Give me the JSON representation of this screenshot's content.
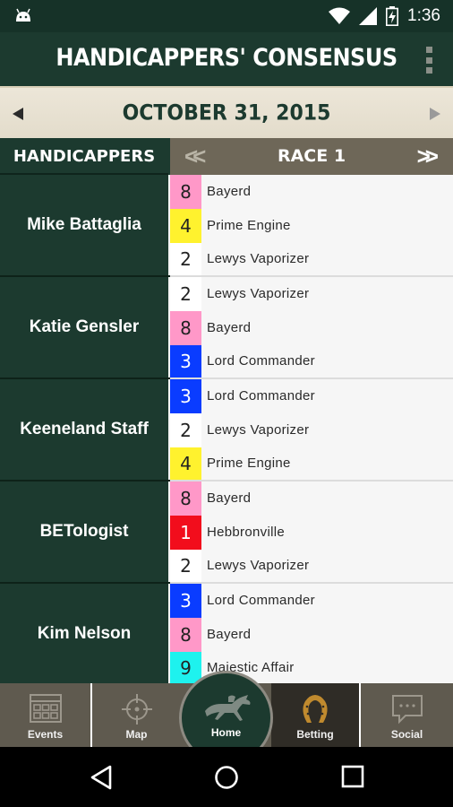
{
  "status_bar": {
    "time": "1:36"
  },
  "app_bar": {
    "title": "HANDICAPPERS' CONSENSUS"
  },
  "date_bar": {
    "date": "OCTOBER 31, 2015"
  },
  "table_header": {
    "handicappers_label": "HANDICAPPERS",
    "race_label": "RACE 1",
    "prev_symbol": "<<",
    "next_symbol": ">>"
  },
  "handicappers": [
    {
      "name": "Mike Battaglia",
      "picks": [
        {
          "number": "8",
          "horse": "Bayerd",
          "bg": "#ff98c8",
          "fg": "#222222"
        },
        {
          "number": "4",
          "horse": "Prime Engine",
          "bg": "#fff22e",
          "fg": "#222222"
        },
        {
          "number": "2",
          "horse": "Lewys Vaporizer",
          "bg": "#ffffff",
          "fg": "#222222"
        }
      ]
    },
    {
      "name": "Katie Gensler",
      "picks": [
        {
          "number": "2",
          "horse": "Lewys Vaporizer",
          "bg": "#ffffff",
          "fg": "#222222"
        },
        {
          "number": "8",
          "horse": "Bayerd",
          "bg": "#ff98c8",
          "fg": "#222222"
        },
        {
          "number": "3",
          "horse": "Lord Commander",
          "bg": "#0a3cff",
          "fg": "#ffffff"
        }
      ]
    },
    {
      "name": "Keeneland Staff",
      "picks": [
        {
          "number": "3",
          "horse": "Lord Commander",
          "bg": "#0a3cff",
          "fg": "#ffffff"
        },
        {
          "number": "2",
          "horse": "Lewys Vaporizer",
          "bg": "#ffffff",
          "fg": "#222222"
        },
        {
          "number": "4",
          "horse": "Prime Engine",
          "bg": "#fff22e",
          "fg": "#222222"
        }
      ]
    },
    {
      "name": "BETologist",
      "picks": [
        {
          "number": "8",
          "horse": "Bayerd",
          "bg": "#ff98c8",
          "fg": "#222222"
        },
        {
          "number": "1",
          "horse": "Hebbronville",
          "bg": "#f20d1c",
          "fg": "#ffffff"
        },
        {
          "number": "2",
          "horse": "Lewys Vaporizer",
          "bg": "#ffffff",
          "fg": "#222222"
        }
      ]
    },
    {
      "name": "Kim Nelson",
      "picks": [
        {
          "number": "3",
          "horse": "Lord Commander",
          "bg": "#0a3cff",
          "fg": "#ffffff"
        },
        {
          "number": "8",
          "horse": "Bayerd",
          "bg": "#ff98c8",
          "fg": "#222222"
        },
        {
          "number": "9",
          "horse": "Majestic Affair",
          "bg": "#1ef2ee",
          "fg": "#222222"
        }
      ]
    }
  ],
  "tabs": {
    "events": "Events",
    "map": "Map",
    "home": "Home",
    "betting": "Betting",
    "social": "Social"
  },
  "icons": {
    "status": [
      "android-icon",
      "wifi-icon",
      "signal-icon",
      "battery-icon"
    ],
    "nav": [
      "back-icon",
      "home-nav-icon",
      "recents-icon"
    ]
  }
}
